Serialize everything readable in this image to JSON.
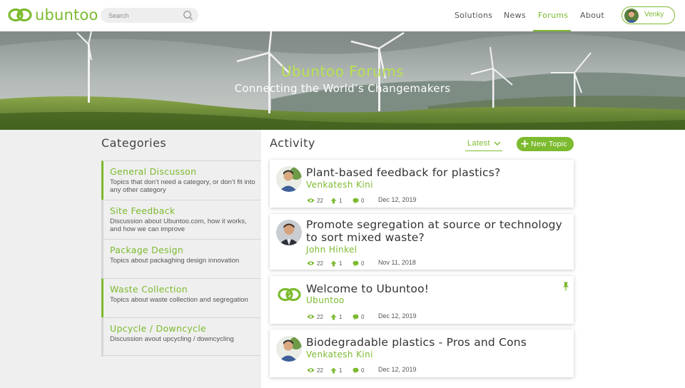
{
  "brand": {
    "name": "ubuntoo",
    "accent": "#7cba2f"
  },
  "search": {
    "placeholder": "Search",
    "icon": "search-icon"
  },
  "nav": {
    "items": [
      {
        "label": "Solutions",
        "active": false
      },
      {
        "label": "News",
        "active": false
      },
      {
        "label": "Forums",
        "active": true
      },
      {
        "label": "About",
        "active": false
      }
    ],
    "user": {
      "name": "Venky"
    }
  },
  "hero": {
    "title": "Ubuntoo Forums",
    "subtitle": "Connecting the World’s Changemakers"
  },
  "categories": {
    "heading": "Categories",
    "items": [
      {
        "title": "General Discusson",
        "desc": "Topics that don’t need a category, or don’t fit into any other category",
        "active": true
      },
      {
        "title": "Site Feedback",
        "desc": "Discussion about Ubuntoo.com, how it works, and how we can improve",
        "active": false
      },
      {
        "title": "Package Design",
        "desc": "Topics about packaghing design innovation",
        "active": false
      },
      {
        "title": "Waste Collection",
        "desc": "Topics about waste collection and segregation",
        "active": true
      },
      {
        "title": "Upcycle / Downcycle",
        "desc": "Discussion avout upcycling / downcycling",
        "active": false
      }
    ]
  },
  "activity": {
    "heading": "Activity",
    "sort_label": "Latest",
    "new_topic_label": "New Topic",
    "topics": [
      {
        "title_lines": [
          "Plant-based feedback for plastics?"
        ],
        "author": "Venkatesh Kini",
        "views": "22",
        "upvotes": "1",
        "comments": "0",
        "date": "Dec 12, 2019",
        "avatar": "user-photo",
        "pinned": false
      },
      {
        "title_lines": [
          "Promote segregation at source or technology",
          "to sort mixed waste?"
        ],
        "author": "John Hinkel",
        "views": "22",
        "upvotes": "1",
        "comments": "0",
        "date": "Nov 11, 2018",
        "avatar": "user-photo",
        "pinned": false
      },
      {
        "title_lines": [
          "Welcome to Ubuntoo!"
        ],
        "author": "Ubuntoo",
        "views": "22",
        "upvotes": "1",
        "comments": "0",
        "date": "Dec 12, 2019",
        "avatar": "ubuntoo-logo",
        "pinned": true
      },
      {
        "title_lines": [
          "Biodegradable plastics - Pros and Cons"
        ],
        "author": "Venkatesh Kini",
        "views": "22",
        "upvotes": "1",
        "comments": "0",
        "date": "Dec 12, 2019",
        "avatar": "user-photo",
        "pinned": false
      }
    ]
  }
}
